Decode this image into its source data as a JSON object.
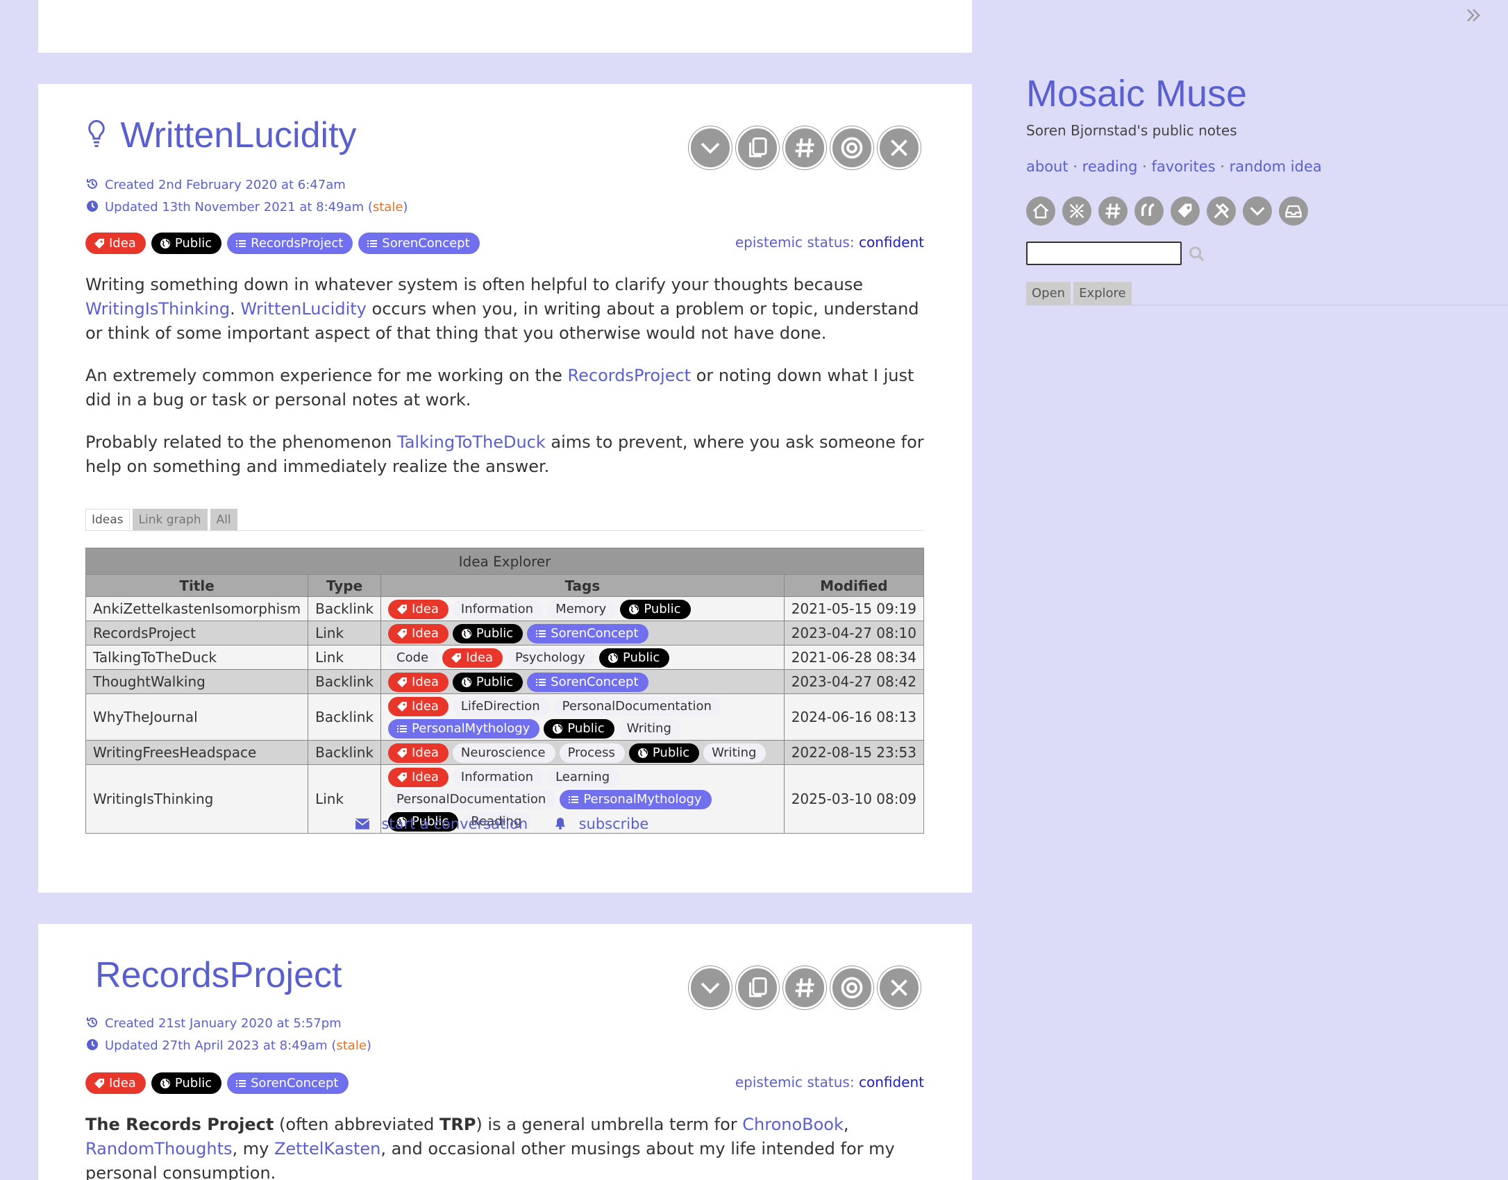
{
  "sidebar": {
    "title": "Mosaic Muse",
    "subtitle": "Soren Bjornstad's public notes",
    "links": [
      "about",
      "reading",
      "favorites",
      "random idea"
    ],
    "search_placeholder": "",
    "tabs": [
      "Open",
      "Explore"
    ],
    "icons": [
      "home-icon",
      "shuffle-icon",
      "hash-icon",
      "quote-icon",
      "tag-icon",
      "tools-icon",
      "chevron-down-icon",
      "inbox-icon"
    ]
  },
  "tiddler1": {
    "title": "WrittenLucidity",
    "created": "Created 2nd February 2020 at 6:47am",
    "updated": "Updated 13th November 2021 at 8:49am",
    "stale": "stale",
    "tags": [
      {
        "label": "Idea",
        "kind": "idea"
      },
      {
        "label": "Public",
        "kind": "public"
      },
      {
        "label": "RecordsProject",
        "kind": "concept"
      },
      {
        "label": "SorenConcept",
        "kind": "concept"
      }
    ],
    "epistemic_label": "epistemic status",
    "epistemic_value": "confident",
    "p1_a": "Writing something down in whatever system is often helpful to clarify your thoughts because ",
    "p1_link1": "WritingIsThinking",
    "p1_b": ".",
    "p1_link2": "WrittenLucidity",
    "p1_c": " occurs when you, in writing about a problem or topic, understand or think of some important aspect of that thing that you otherwise would not have done.",
    "p2_a": "An extremely common experience for me working on the ",
    "p2_link": "RecordsProject",
    "p2_b": " or noting down what I just did in a bug or task or personal notes at work.",
    "p3_a": "Probably related to the phenomenon ",
    "p3_link": "TalkingToTheDuck",
    "p3_b": " aims to prevent, where you ask someone for help on something and immediately realize the answer.",
    "tabs": [
      "Ideas",
      "Link graph",
      "All"
    ],
    "explorer": {
      "caption": "Idea Explorer",
      "columns": [
        "Title",
        "Type",
        "Tags",
        "Modified"
      ],
      "rows": [
        {
          "title": "AnkiZettelkastenIsomorphism",
          "type": "Backlink",
          "modified": "2021-05-15 09:19",
          "tags": [
            {
              "label": "Idea",
              "kind": "idea"
            },
            {
              "label": "Information",
              "kind": "plain"
            },
            {
              "label": "Memory",
              "kind": "plain"
            },
            {
              "label": "Public",
              "kind": "public"
            }
          ]
        },
        {
          "title": "RecordsProject",
          "type": "Link",
          "modified": "2023-04-27 08:10",
          "tags": [
            {
              "label": "Idea",
              "kind": "idea"
            },
            {
              "label": "Public",
              "kind": "public"
            },
            {
              "label": "SorenConcept",
              "kind": "concept"
            }
          ]
        },
        {
          "title": "TalkingToTheDuck",
          "type": "Link",
          "modified": "2021-06-28 08:34",
          "tags": [
            {
              "label": "Code",
              "kind": "plain"
            },
            {
              "label": "Idea",
              "kind": "idea"
            },
            {
              "label": "Psychology",
              "kind": "plain"
            },
            {
              "label": "Public",
              "kind": "public"
            }
          ]
        },
        {
          "title": "ThoughtWalking",
          "type": "Backlink",
          "modified": "2023-04-27 08:42",
          "tags": [
            {
              "label": "Idea",
              "kind": "idea"
            },
            {
              "label": "Public",
              "kind": "public"
            },
            {
              "label": "SorenConcept",
              "kind": "concept"
            }
          ]
        },
        {
          "title": "WhyTheJournal",
          "type": "Backlink",
          "modified": "2024-06-16 08:13",
          "tags": [
            {
              "label": "Idea",
              "kind": "idea"
            },
            {
              "label": "LifeDirection",
              "kind": "plain"
            },
            {
              "label": "PersonalDocumentation",
              "kind": "plain"
            },
            {
              "label": "PersonalMythology",
              "kind": "concept"
            },
            {
              "label": "Public",
              "kind": "public"
            },
            {
              "label": "Writing",
              "kind": "plain"
            }
          ]
        },
        {
          "title": "WritingFreesHeadspace",
          "type": "Backlink",
          "modified": "2022-08-15 23:53",
          "tags": [
            {
              "label": "Idea",
              "kind": "idea"
            },
            {
              "label": "Neuroscience",
              "kind": "plain"
            },
            {
              "label": "Process",
              "kind": "plain"
            },
            {
              "label": "Public",
              "kind": "public"
            },
            {
              "label": "Writing",
              "kind": "plain"
            }
          ]
        },
        {
          "title": "WritingIsThinking",
          "type": "Link",
          "modified": "2025-03-10 08:09",
          "tags": [
            {
              "label": "Idea",
              "kind": "idea"
            },
            {
              "label": "Information",
              "kind": "plain"
            },
            {
              "label": "Learning",
              "kind": "plain"
            },
            {
              "label": "PersonalDocumentation",
              "kind": "plain"
            },
            {
              "label": "PersonalMythology",
              "kind": "concept"
            },
            {
              "label": "Public",
              "kind": "public"
            },
            {
              "label": "Reading",
              "kind": "plain"
            }
          ]
        }
      ]
    },
    "footer_conversation": "start a conversation",
    "footer_subscribe": "subscribe"
  },
  "tiddler2": {
    "title": "RecordsProject",
    "created": "Created 21st January 2020 at 5:57pm",
    "updated": "Updated 27th April 2023 at 8:49am",
    "stale": "stale",
    "tags": [
      {
        "label": "Idea",
        "kind": "idea"
      },
      {
        "label": "Public",
        "kind": "public"
      },
      {
        "label": "SorenConcept",
        "kind": "concept"
      }
    ],
    "epistemic_label": "epistemic status",
    "epistemic_value": "confident",
    "bold1": "The Records Project",
    "t1": " (often abbreviated ",
    "bold2": "TRP",
    "t2": ") is a general umbrella term for ",
    "link1": "ChronoBook",
    "t3": ", ",
    "link2": "RandomThoughts",
    "t4": ", my ",
    "link3": "ZettelKasten",
    "t5": ", and occasional other musings about my life intended for my personal consumption."
  },
  "colors": {
    "accent": "#5a5fd0",
    "idea": "#e8362a",
    "public": "#000000",
    "concept": "#7070ee",
    "stale": "#e0732c",
    "background": "#dcdcf8"
  }
}
